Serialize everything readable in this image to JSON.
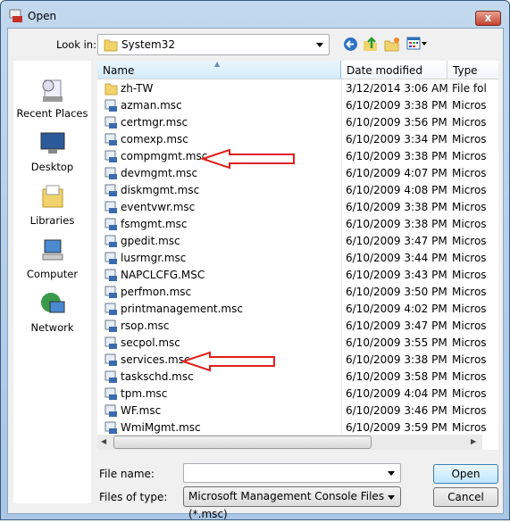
{
  "window": {
    "title": "Open",
    "close": "x"
  },
  "toolbar": {
    "look_in_label": "Look in:",
    "look_in_value": "System32",
    "icons": [
      "back-icon",
      "up-folder-icon",
      "new-folder-icon",
      "view-menu-icon"
    ]
  },
  "sidebar": {
    "items": [
      {
        "label": "Recent Places",
        "icon": "recent-places-icon"
      },
      {
        "label": "Desktop",
        "icon": "desktop-icon"
      },
      {
        "label": "Libraries",
        "icon": "libraries-icon"
      },
      {
        "label": "Computer",
        "icon": "computer-icon"
      },
      {
        "label": "Network",
        "icon": "network-icon"
      }
    ]
  },
  "list": {
    "columns": [
      "Name",
      "Date modified",
      "Type"
    ],
    "rows": [
      {
        "name": "zh-TW",
        "date": "3/12/2014 3:06 AM",
        "type": "File fol",
        "icon": "folder"
      },
      {
        "name": "azman.msc",
        "date": "6/10/2009 3:38 PM",
        "type": "Micros",
        "icon": "msc"
      },
      {
        "name": "certmgr.msc",
        "date": "6/10/2009 3:56 PM",
        "type": "Micros",
        "icon": "msc"
      },
      {
        "name": "comexp.msc",
        "date": "6/10/2009 3:34 PM",
        "type": "Micros",
        "icon": "msc"
      },
      {
        "name": "compmgmt.msc",
        "date": "6/10/2009 3:38 PM",
        "type": "Micros",
        "icon": "msc"
      },
      {
        "name": "devmgmt.msc",
        "date": "6/10/2009 4:07 PM",
        "type": "Micros",
        "icon": "msc"
      },
      {
        "name": "diskmgmt.msc",
        "date": "6/10/2009 4:08 PM",
        "type": "Micros",
        "icon": "msc"
      },
      {
        "name": "eventvwr.msc",
        "date": "6/10/2009 3:38 PM",
        "type": "Micros",
        "icon": "msc"
      },
      {
        "name": "fsmgmt.msc",
        "date": "6/10/2009 3:38 PM",
        "type": "Micros",
        "icon": "msc"
      },
      {
        "name": "gpedit.msc",
        "date": "6/10/2009 3:47 PM",
        "type": "Micros",
        "icon": "msc"
      },
      {
        "name": "lusrmgr.msc",
        "date": "6/10/2009 3:44 PM",
        "type": "Micros",
        "icon": "msc"
      },
      {
        "name": "NAPCLCFG.MSC",
        "date": "6/10/2009 3:43 PM",
        "type": "Micros",
        "icon": "msc"
      },
      {
        "name": "perfmon.msc",
        "date": "6/10/2009 3:50 PM",
        "type": "Micros",
        "icon": "msc"
      },
      {
        "name": "printmanagement.msc",
        "date": "6/10/2009 4:02 PM",
        "type": "Micros",
        "icon": "msc"
      },
      {
        "name": "rsop.msc",
        "date": "6/10/2009 3:47 PM",
        "type": "Micros",
        "icon": "msc"
      },
      {
        "name": "secpol.msc",
        "date": "6/10/2009 3:55 PM",
        "type": "Micros",
        "icon": "msc"
      },
      {
        "name": "services.msc",
        "date": "6/10/2009 3:38 PM",
        "type": "Micros",
        "icon": "msc"
      },
      {
        "name": "taskschd.msc",
        "date": "6/10/2009 3:58 PM",
        "type": "Micros",
        "icon": "msc"
      },
      {
        "name": "tpm.msc",
        "date": "6/10/2009 4:04 PM",
        "type": "Micros",
        "icon": "msc"
      },
      {
        "name": "WF.msc",
        "date": "6/10/2009 3:46 PM",
        "type": "Micros",
        "icon": "msc"
      },
      {
        "name": "WmiMgmt.msc",
        "date": "6/10/2009 3:59 PM",
        "type": "Micros",
        "icon": "msc"
      }
    ],
    "vertical_scroll_position": 0.85,
    "annotations": [
      {
        "target": "compmgmt.msc",
        "shape": "red-arrow"
      },
      {
        "target": "services.msc",
        "shape": "red-arrow"
      }
    ]
  },
  "footer": {
    "file_name_label": "File name:",
    "file_name_value": "",
    "files_of_type_label": "Files of type:",
    "files_of_type_value": "Microsoft Management Console Files (*.msc)",
    "open": "Open",
    "cancel": "Cancel"
  },
  "colors": {
    "arrow": "#e0201b",
    "accent": "#3c7fb1"
  }
}
